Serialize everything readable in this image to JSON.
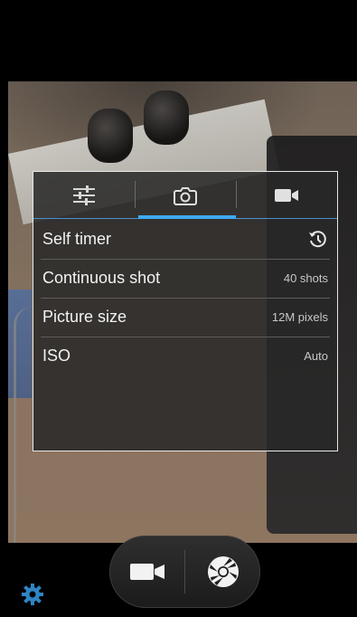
{
  "settings_panel": {
    "tabs": [
      {
        "name": "general-settings",
        "icon": "sliders-icon",
        "selected": false
      },
      {
        "name": "photo-settings",
        "icon": "camera-icon",
        "selected": true
      },
      {
        "name": "video-settings",
        "icon": "video-camera-icon",
        "selected": false
      }
    ],
    "rows": [
      {
        "label": "Self timer",
        "value": "",
        "icon": "timer-icon"
      },
      {
        "label": "Continuous shot",
        "value": "40 shots"
      },
      {
        "label": "Picture size",
        "value": "12M pixels"
      },
      {
        "label": "ISO",
        "value": "Auto"
      }
    ]
  },
  "controls": {
    "mode_video_icon": "video-camera-icon",
    "shutter_icon": "shutter-aperture-icon",
    "settings_icon": "gear-icon"
  },
  "colors": {
    "accent": "#3fa9f5",
    "gear": "#2f84c4"
  }
}
